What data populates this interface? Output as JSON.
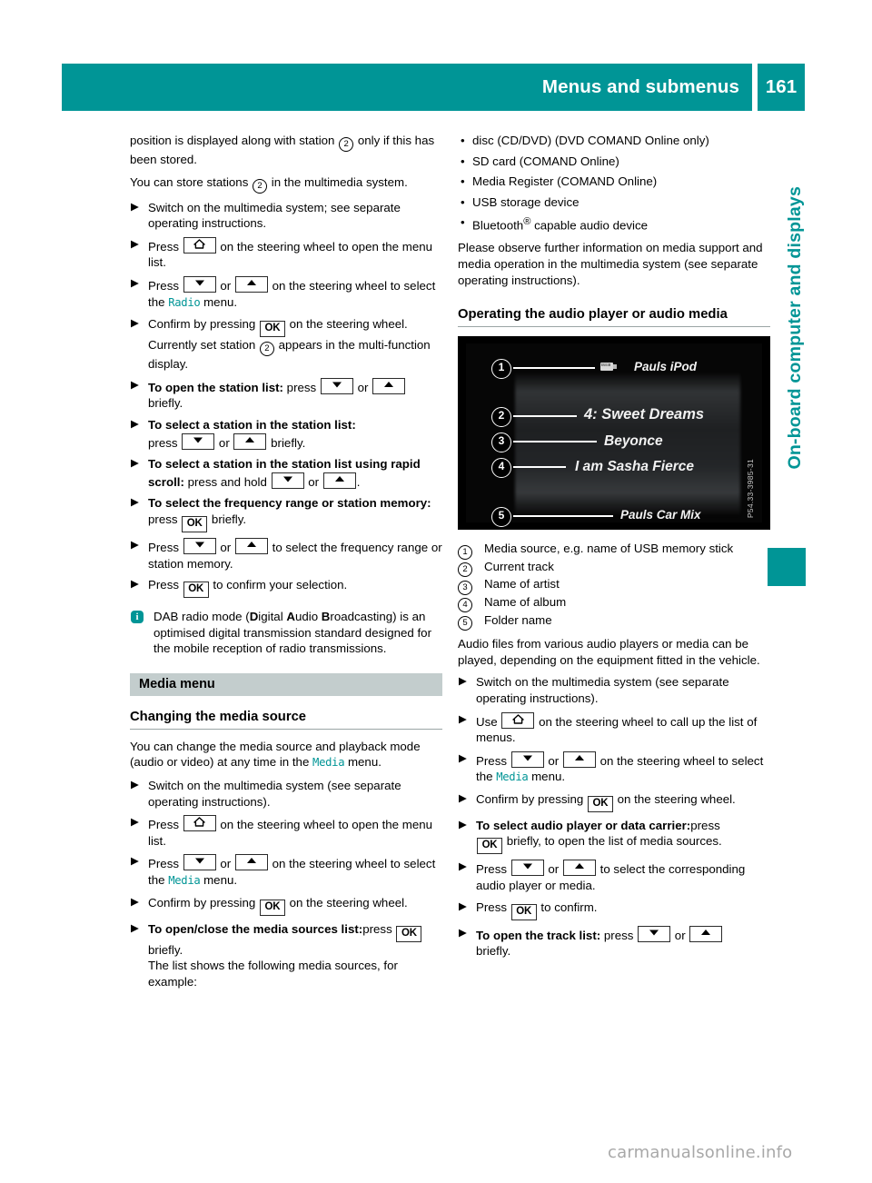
{
  "header": {
    "title": "Menus and submenus",
    "page_number": "161"
  },
  "side_tab": {
    "label": "On-board computer and displays"
  },
  "colors": {
    "teal": "#009596",
    "section_bar_grey": "#c3cdcd",
    "rule_grey": "#9aa5a5"
  },
  "left_column": {
    "intro_1": "position is displayed along with station  only if this has been stored.",
    "intro_1_pre": "position is displayed along with station",
    "intro_1_post": "only if this has been stored.",
    "intro_2_pre": "You can store stations",
    "intro_2_post": "in the multimedia system.",
    "step_1": "Switch on the multimedia system; see separate operating instructions.",
    "step_2_pre": "Press",
    "step_2_post": "on the steering wheel to open the menu list.",
    "step_3_pre": "Press",
    "step_3_mid": "or",
    "step_3_post": "on the steering wheel to select the",
    "step_3_menu": "Radio",
    "step_3_tail": "menu.",
    "step_4_pre": "Confirm by pressing",
    "step_4_post": "on the steering wheel.",
    "step_4_sub_pre": "Currently set station",
    "step_4_sub_post": "appears in the multi-function display.",
    "step_5_bold": "To open the station list:",
    "step_5_pre": "press",
    "step_5_mid": "or",
    "step_5_post": "briefly.",
    "step_6_bold": "To select a station in the station list:",
    "step_6_pre": "press",
    "step_6_mid": "or",
    "step_6_post": "briefly.",
    "step_7_bold": "To select a station in the station list using rapid scroll:",
    "step_7_pre": "press and hold",
    "step_7_mid": "or",
    "step_7_post": ".",
    "step_8_bold": "To select the frequency range or station memory:",
    "step_8_pre": "press",
    "step_8_post": "briefly.",
    "step_9_pre": "Press",
    "step_9_mid": "or",
    "step_9_post": "to select the frequency range or station memory.",
    "step_10_pre": "Press",
    "step_10_post": "to confirm your selection.",
    "info_text_pre": "DAB radio mode (",
    "info_b1": "D",
    "info_t1": "igital ",
    "info_b2": "A",
    "info_t2": "udio ",
    "info_b3": "B",
    "info_t3": "roadcasting) is an optimised digital transmission standard designed for the mobile reception of radio transmissions.",
    "section_bar": "Media menu",
    "heading": "Changing the media source",
    "body_1_pre": "You can change the media source and playback mode (audio or video) at any time in the",
    "body_1_menu": "Media",
    "body_1_post": "menu.",
    "m_step_1": "Switch on the multimedia system (see separate operating instructions).",
    "m_step_2_pre": "Press",
    "m_step_2_post": "on the steering wheel to open the menu list.",
    "m_step_3_pre": "Press",
    "m_step_3_mid": "or",
    "m_step_3_post": "on the steering wheel to select the",
    "m_step_3_menu": "Media",
    "m_step_3_tail": "menu.",
    "m_step_4_pre": "Confirm by pressing",
    "m_step_4_post": "on the steering wheel.",
    "m_step_5_bold": "To open/close the media sources list:",
    "m_step_5_pre": "press",
    "m_step_5_post": "briefly.",
    "m_step_5_sub": "The list shows the following media sources, for example:"
  },
  "right_column": {
    "bullets": [
      "disc (CD/DVD) (DVD COMAND Online only)",
      "SD card (COMAND Online)",
      "Media Register (COMAND Online)",
      "USB storage device"
    ],
    "bullet_bluetooth_pre": "Bluetooth",
    "bullet_bluetooth_sup": "®",
    "bullet_bluetooth_post": "capable audio device",
    "observe_text": "Please observe further information on media support and media operation in the multimedia system (see separate operating instructions).",
    "heading": "Operating the audio player or audio media",
    "figure": {
      "source_name": "Pauls iPod",
      "track": "4: Sweet Dreams",
      "artist": "Beyonce",
      "album": "I am Sasha Fierce",
      "folder": "Pauls Car Mix",
      "callouts": [
        "1",
        "2",
        "3",
        "4",
        "5"
      ],
      "image_code": "P54.33-3985-31",
      "usb_label": "USB"
    },
    "legend": [
      {
        "num": "1",
        "text": "Media source, e.g. name of USB memory stick"
      },
      {
        "num": "2",
        "text": "Current track"
      },
      {
        "num": "3",
        "text": "Name of artist"
      },
      {
        "num": "4",
        "text": "Name of album"
      },
      {
        "num": "5",
        "text": "Folder name"
      }
    ],
    "audio_text": "Audio files from various audio players or media can be played, depending on the equipment fitted in the vehicle.",
    "r_step_1": "Switch on the multimedia system (see separate operating instructions).",
    "r_step_2_pre": "Use",
    "r_step_2_post": "on the steering wheel to call up the list of menus.",
    "r_step_3_pre": "Press",
    "r_step_3_mid": "or",
    "r_step_3_post": "on the steering wheel to select the",
    "r_step_3_menu": "Media",
    "r_step_3_tail": "menu.",
    "r_step_4_pre": "Confirm by pressing",
    "r_step_4_post": "on the steering wheel.",
    "r_step_5_bold": "To select audio player or data carrier:",
    "r_step_5_pre": "press",
    "r_step_5_post": "briefly, to open the list of media sources.",
    "r_step_6_pre": "Press",
    "r_step_6_mid": "or",
    "r_step_6_post": "to select the corresponding audio player or media.",
    "r_step_7_pre": "Press",
    "r_step_7_post": "to confirm.",
    "r_step_8_bold": "To open the track list:",
    "r_step_8_pre": "press",
    "r_step_8_mid": "or",
    "r_step_8_post": "briefly."
  },
  "keys": {
    "ok": "OK",
    "down": "down-arrow",
    "up": "up-arrow",
    "home": "home"
  },
  "watermark": "carmanualsonline.info"
}
